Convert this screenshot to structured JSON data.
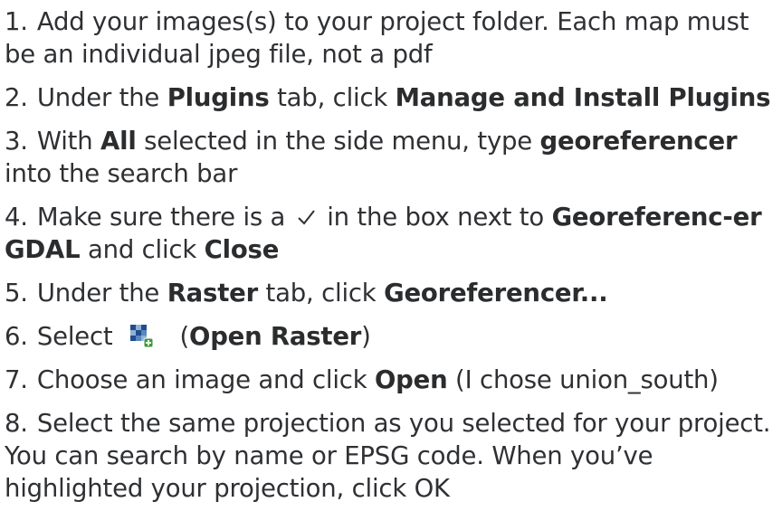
{
  "steps": [
    {
      "num": "1.",
      "text": "Add your images(s) to your project folder. Each map must be an individual jpeg file, not a pdf"
    },
    {
      "num": "2.",
      "t1": "Under the ",
      "b1": "Plugins",
      "t2": " tab, click ",
      "b2": "Manage and Install Plugins"
    },
    {
      "num": "3.",
      "t1": "With ",
      "b1": "All",
      "t2": " selected in the side menu, type ",
      "b2": "georeferencer",
      "t3": " into the search bar"
    },
    {
      "num": "4.",
      "t1": "Make sure there is a",
      "t2": "in the box next to ",
      "b1": "Georeferenc-er GDAL",
      "t3": " and click ",
      "b2": "Close"
    },
    {
      "num": "5.",
      "t1": "Under the ",
      "b1": "Raster",
      "t2": " tab, click ",
      "b2": "Georeferencer..."
    },
    {
      "num": "6.",
      "t1": "Select",
      "t2": "(",
      "b1": "Open Raster",
      "t3": ")"
    },
    {
      "num": "7.",
      "t1": "Choose an image and click ",
      "b1": "Open",
      "t2": " (I chose union_south)"
    },
    {
      "num": "8.",
      "text": "Select the same projection as you selected for your project. You can search by name or EPSG code. When you’ve highlighted your projection, click OK"
    }
  ],
  "icons": {
    "check": "checkmark-icon",
    "raster": "open-raster-icon"
  },
  "colors": {
    "text": "#2f3033",
    "icon_blue_dark": "#1f4e8c",
    "icon_blue_light": "#8fb1d9",
    "icon_green": "#3a9a3a"
  }
}
